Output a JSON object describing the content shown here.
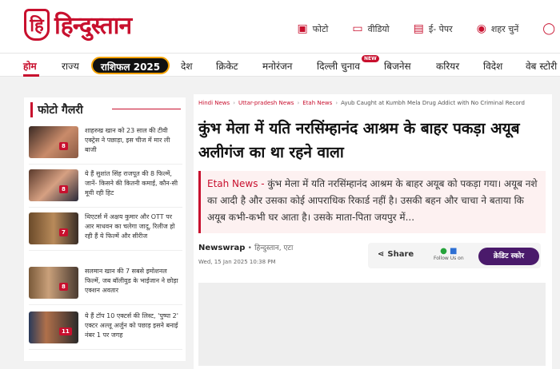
{
  "header": {
    "logo_mark": "हि",
    "logo_text": "हिन्दुस्तान",
    "links": [
      {
        "icon": "photo-icon",
        "glyph": "▣",
        "label": "फोटो"
      },
      {
        "icon": "video-icon",
        "glyph": "▭",
        "label": "वीडियो"
      },
      {
        "icon": "epaper-icon",
        "glyph": "▤",
        "label": "ई- पेपर"
      },
      {
        "icon": "location-icon",
        "glyph": "◉",
        "label": "शहर चुनें"
      },
      {
        "icon": "user-icon",
        "glyph": "◯",
        "label": ""
      }
    ]
  },
  "nav": {
    "items": [
      "होम",
      "राज्य",
      "राशिफल 2025",
      "देश",
      "क्रिकेट",
      "मनोरंजन",
      "दिल्ली चुनाव",
      "बिजनेस",
      "करियर",
      "विदेश",
      "वेब स्टोरी"
    ],
    "new_badge": "NEW"
  },
  "gallery": {
    "title": "फोटो गैलरी",
    "items": [
      {
        "count": "8",
        "text": "शाहरुख खान को 23 साल की टीवी एक्ट्रेस ने पछाड़ा, इस चीज में मार ली बाजी"
      },
      {
        "count": "8",
        "text": "ये हैं सुशांत सिंह राजपूत की 8 फिल्में, जानें- किसने की कितनी कमाई, कौन-सी मूवी रही हिट"
      },
      {
        "count": "7",
        "text": "थिएटर्स में अक्षय कुमार और OTT पर आर माधवन का चलेगा जादू, रिलीज हो रही हैं ये फिल्में और सीरीज"
      },
      {
        "count": "8",
        "text": "सलमान खान की 7 सबसे इमोशनल फिल्में, जब बॉलीवुड के भाईजान ने छोड़ा एक्शन अवतार"
      },
      {
        "count": "11",
        "text": "ये हैं टॉप 10 एक्टर्स की लिस्ट, 'पुष्पा 2' एक्टर अल्लू अर्जुन को पछाड़ इसने बनाई नंबर 1 पर जगह"
      }
    ]
  },
  "article": {
    "breadcrumbs": [
      "Hindi News",
      "Uttar-pradesh News",
      "Etah News"
    ],
    "breadcrumb_current": "Ayub Caught at Kumbh Mela Drug Addict with No Criminal Record",
    "headline": "कुंभ मेला में यति नरसिंम्हानंद आश्रम के बाहर पकड़ा अयूब अलीगंज का था रहने वाला",
    "summary_source": "Etah News - ",
    "summary_text": "कुंभ मेला में यति नरसिंम्हानंद आश्रम के बाहर अयूब को पकड़ा गया। अयूब नशे का आदी है और उसका कोई आपराधिक रिकार्ड नहीं है। उसकी बहन और चाचा ने बताया कि अयूब कभी-कभी घर आता है। उसके माता-पिता जयपुर में...",
    "author": "Newswrap",
    "location": "हिन्दुस्तान, एटा",
    "date": "Wed, 15 Jan 2025 10:38 PM",
    "share_label": "Share",
    "follow_label": "Follow Us on",
    "credit_label": "क्रेडिट स्कोर"
  }
}
